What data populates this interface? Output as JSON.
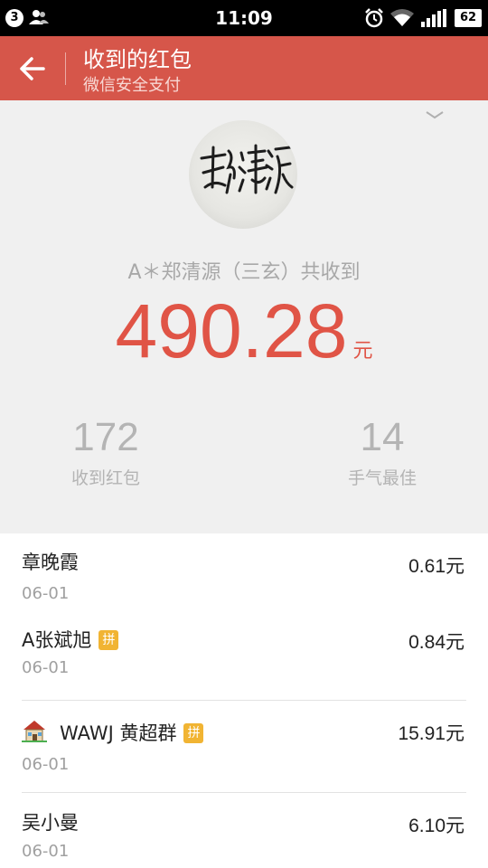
{
  "status_bar": {
    "notification_count": "3",
    "time": "11:09",
    "battery": "62"
  },
  "header": {
    "title": "收到的红包",
    "subtitle": "微信安全支付"
  },
  "summary": {
    "name_line": "A＊郑清源（三玄）共收到",
    "amount": "490.28",
    "unit": "元",
    "received_count": "172",
    "received_label": "收到红包",
    "best_luck_count": "14",
    "best_luck_label": "手气最佳"
  },
  "records": [
    {
      "name": "章晚霞",
      "date": "06-01",
      "amount": "0.61元",
      "badge": ""
    },
    {
      "name": "A张斌旭",
      "date": "06-01",
      "amount": "0.84元",
      "badge": "拼"
    },
    {
      "name": "WAWJ 黄超群",
      "date": "06-01",
      "amount": "15.91元",
      "badge": "拼",
      "icon": "house-icon"
    },
    {
      "name": "吴小曼",
      "date": "06-01",
      "amount": "6.10元",
      "badge": ""
    }
  ],
  "colors": {
    "header": "#d6564a",
    "amount": "#e05446",
    "badge": "#f1b433"
  }
}
